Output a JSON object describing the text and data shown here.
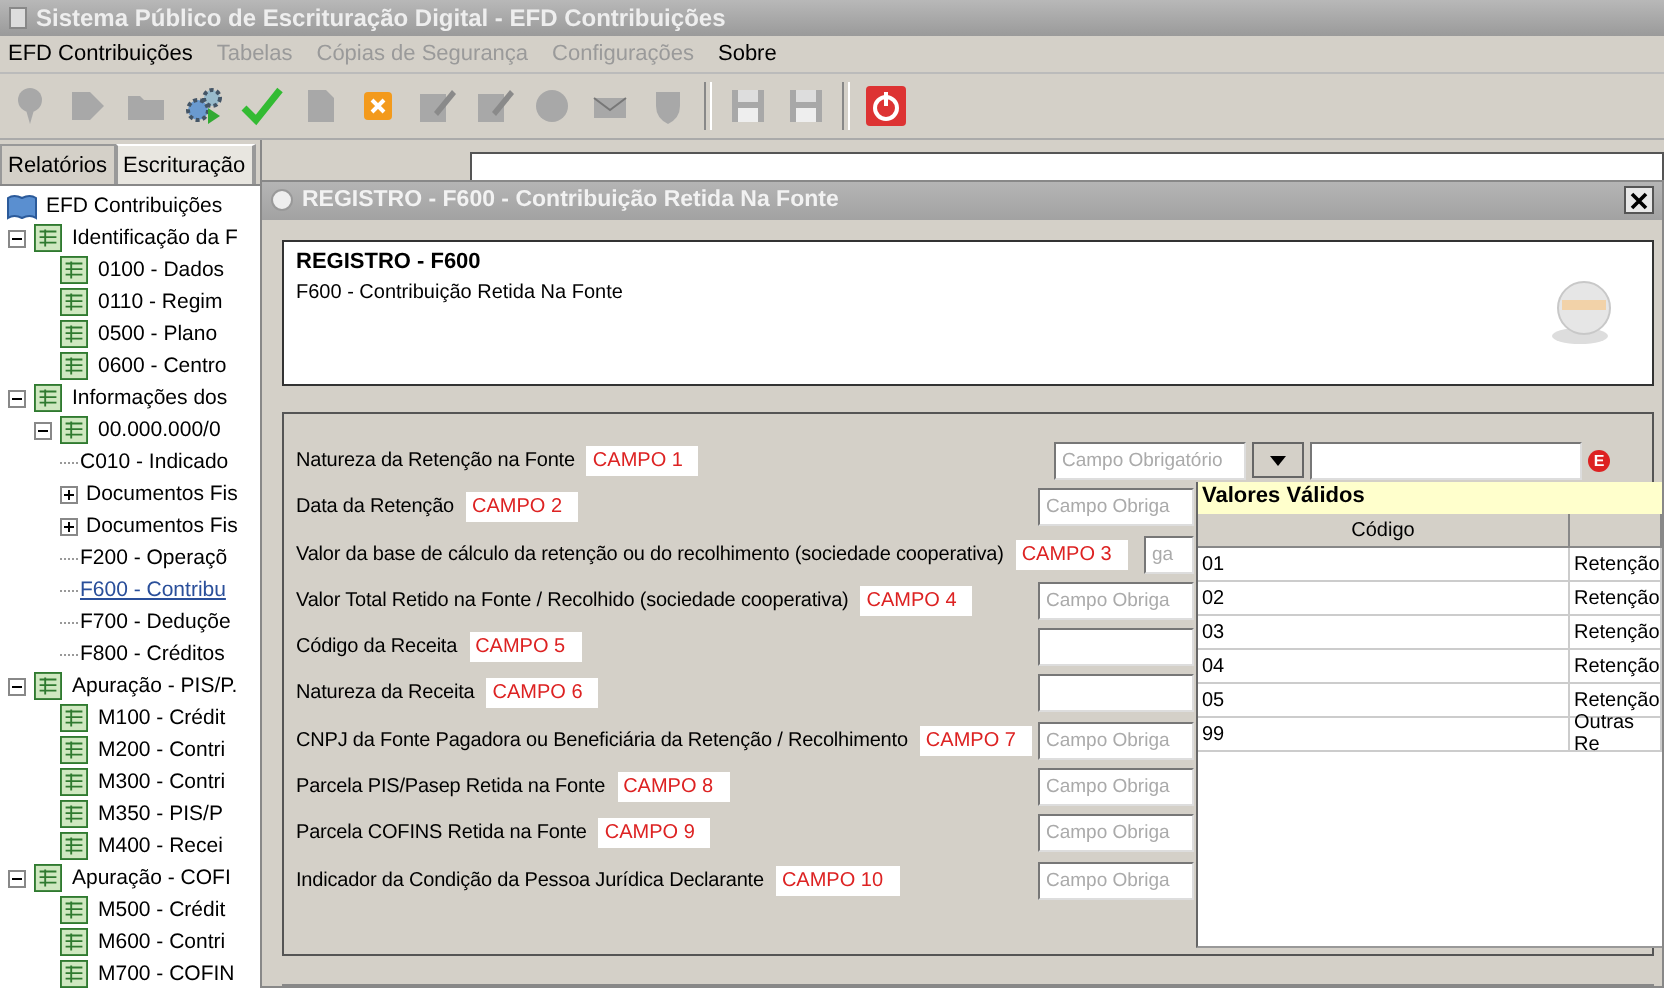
{
  "window": {
    "title": "Sistema Público de Escrituração Digital - EFD Contribuições"
  },
  "menu": [
    {
      "label": "EFD Contribuições",
      "disabled": false
    },
    {
      "label": "Tabelas",
      "disabled": true
    },
    {
      "label": "Cópias de Segurança",
      "disabled": true
    },
    {
      "label": "Configurações",
      "disabled": true
    },
    {
      "label": "Sobre",
      "disabled": false
    }
  ],
  "toolbar": [
    {
      "kind": "pin",
      "disabled": true
    },
    {
      "kind": "arrow",
      "disabled": true
    },
    {
      "kind": "folder",
      "disabled": true
    },
    {
      "kind": "gears",
      "disabled": false
    },
    {
      "kind": "check",
      "disabled": false
    },
    {
      "kind": "page",
      "disabled": true
    },
    {
      "kind": "cancel",
      "disabled": false
    },
    {
      "kind": "edit",
      "disabled": true
    },
    {
      "kind": "edit",
      "disabled": true
    },
    {
      "kind": "globe",
      "disabled": true
    },
    {
      "kind": "mail",
      "disabled": true
    },
    {
      "kind": "shield",
      "disabled": true
    },
    {
      "kind": "separator"
    },
    {
      "kind": "save",
      "disabled": true
    },
    {
      "kind": "save",
      "disabled": true
    },
    {
      "kind": "separator"
    },
    {
      "kind": "power",
      "disabled": false
    }
  ],
  "side_tabs": [
    {
      "label": "Relatórios",
      "selected": false
    },
    {
      "label": "Escrituração",
      "selected": true
    }
  ],
  "tree": {
    "label": "EFD Contribuições",
    "selected": false,
    "children": [
      {
        "label": "Identificação da F",
        "kind": "sheet",
        "selected": false,
        "expanded": true,
        "children": [
          {
            "label": "0100 - Dados",
            "kind": "sheet",
            "selected": false
          },
          {
            "label": "0110 - Regim",
            "kind": "sheet",
            "selected": false
          },
          {
            "label": "0500 - Plano",
            "kind": "sheet",
            "selected": false
          },
          {
            "label": "0600 - Centro",
            "kind": "sheet",
            "selected": false
          }
        ]
      },
      {
        "label": "Informações dos",
        "kind": "sheet",
        "selected": false,
        "expanded": true,
        "children": [
          {
            "label": "00.000.000/0",
            "kind": "sheet",
            "selected": false,
            "expanded": true,
            "children": [
              {
                "label": "C010 - Indicado",
                "kind": "plain",
                "selected": false
              },
              {
                "label": "Documentos Fis",
                "kind": "plain",
                "selected": false,
                "expanded": false
              },
              {
                "label": "Documentos Fis",
                "kind": "plain",
                "selected": false,
                "expanded": false
              },
              {
                "label": "F200 - Operaçõ",
                "kind": "plain",
                "selected": false
              },
              {
                "label": "F600 - Contribu",
                "kind": "plain",
                "selected": true
              },
              {
                "label": "F700 - Deduçõe",
                "kind": "plain",
                "selected": false
              },
              {
                "label": "F800 - Créditos",
                "kind": "plain",
                "selected": false
              }
            ]
          }
        ]
      },
      {
        "label": "Apuração - PIS/P.",
        "kind": "sheet",
        "selected": false,
        "expanded": true,
        "children": [
          {
            "label": "M100 - Crédit",
            "kind": "sheet",
            "selected": false
          },
          {
            "label": "M200 - Contri",
            "kind": "sheet",
            "selected": false
          },
          {
            "label": "M300 - Contri",
            "kind": "sheet",
            "selected": false
          },
          {
            "label": "M350 - PIS/P",
            "kind": "sheet",
            "selected": false
          },
          {
            "label": "M400 - Recei",
            "kind": "sheet",
            "selected": false
          }
        ]
      },
      {
        "label": "Apuração - COFI",
        "kind": "sheet",
        "selected": false,
        "expanded": true,
        "children": [
          {
            "label": "M500 - Crédit",
            "kind": "sheet",
            "selected": false
          },
          {
            "label": "M600 - Contri",
            "kind": "sheet",
            "selected": false
          },
          {
            "label": "M700 - COFIN",
            "kind": "sheet",
            "selected": false
          }
        ]
      }
    ]
  },
  "dialog": {
    "title": "REGISTRO - F600 - Contribuição Retida Na Fonte",
    "heading": "REGISTRO - F600",
    "subheading": "F600 - Contribuição Retida Na Fonte",
    "fields": [
      {
        "label": "Natureza da Retenção na Fonte",
        "tag": "CAMPO 1",
        "kind": "select",
        "placeholder": "Campo Obrigatório",
        "error": "E"
      },
      {
        "label": "Data da Retenção",
        "tag": "CAMPO 2",
        "kind": "text",
        "placeholder": "Campo Obriga"
      },
      {
        "label": "Valor da base de cálculo da retenção ou do recolhimento (sociedade cooperativa)",
        "tag": "CAMPO 3",
        "kind": "text",
        "placeholder": "ga"
      },
      {
        "label": "Valor Total Retido na Fonte / Recolhido (sociedade cooperativa)",
        "tag": "CAMPO 4",
        "kind": "text",
        "placeholder": "Campo Obriga"
      },
      {
        "label": "Código da Receita",
        "tag": "CAMPO 5",
        "kind": "text"
      },
      {
        "label": "Natureza da Receita",
        "tag": "CAMPO 6",
        "kind": "text"
      },
      {
        "label": "CNPJ da Fonte Pagadora ou Beneficiária da Retenção / Recolhimento",
        "tag": "CAMPO 7",
        "kind": "text",
        "placeholder": "Campo Obriga"
      },
      {
        "label": "Parcela PIS/Pasep Retida na Fonte",
        "tag": "CAMPO 8",
        "kind": "text",
        "placeholder": "Campo Obriga"
      },
      {
        "label": "Parcela COFINS Retida na Fonte",
        "tag": "CAMPO 9",
        "kind": "text",
        "placeholder": "Campo Obriga"
      },
      {
        "label": "Indicador da Condição da Pessoa Jurídica Declarante",
        "tag": "CAMPO 10",
        "kind": "text",
        "placeholder": "Campo Obriga"
      }
    ]
  },
  "valid_values": {
    "title": "Valores Válidos",
    "columns": [
      "Código"
    ],
    "rows": [
      {
        "code": "01",
        "description": "Retenção"
      },
      {
        "code": "02",
        "description": "Retenção"
      },
      {
        "code": "03",
        "description": "Retenção"
      },
      {
        "code": "04",
        "description": "Retenção"
      },
      {
        "code": "05",
        "description": "Retenção"
      },
      {
        "code": "99",
        "description": "Outras Re"
      }
    ]
  }
}
